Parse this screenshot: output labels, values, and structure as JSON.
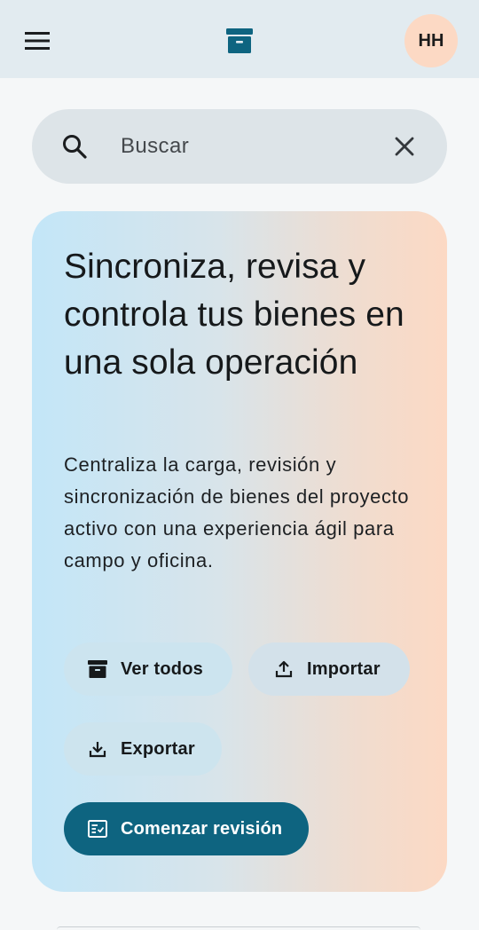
{
  "topbar": {
    "menu_icon": "menu-icon",
    "logo_icon": "archive-box-icon",
    "avatar_initials": "HH",
    "colors": {
      "background": "#e2ebf0",
      "logo": "#0e6480",
      "avatar_bg": "#fcd9c4"
    }
  },
  "search": {
    "placeholder": "Buscar",
    "value": "",
    "search_icon": "search-icon",
    "clear_icon": "close-icon"
  },
  "hero": {
    "title": "Sincroniza, revisa y controla tus bienes en una sola operación",
    "description": "Centraliza la carga, revisión y sincronización de bienes del proyecto activo con una experiencia ágil para campo y oficina.",
    "actions": {
      "view_all": {
        "label": "Ver todos",
        "icon": "archive-icon"
      },
      "import": {
        "label": "Importar",
        "icon": "upload-icon"
      },
      "export": {
        "label": "Exportar",
        "icon": "download-icon"
      },
      "start_review": {
        "label": "Comenzar revisión",
        "icon": "checklist-icon"
      }
    },
    "colors": {
      "gradient_start": "#c3e6f8",
      "gradient_end": "#fcd9c4",
      "primary": "#0e6480"
    }
  }
}
